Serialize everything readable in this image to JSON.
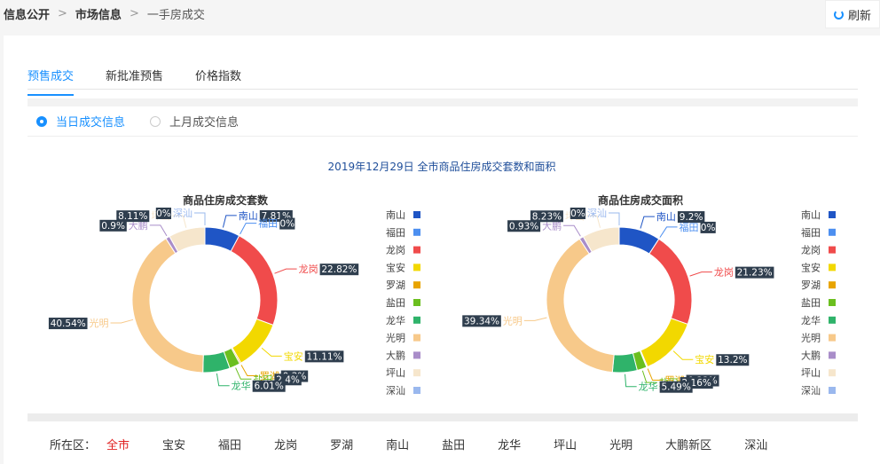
{
  "breadcrumb": [
    "信息公开",
    "市场信息",
    "一手房成交"
  ],
  "refresh_label": "刷新",
  "tabs": [
    "预售成交",
    "新批准预售",
    "价格指数"
  ],
  "radios": [
    "当日成交信息",
    "上月成交信息"
  ],
  "main_title": "2019年12月29日 全市商品住房成交套数和面积",
  "district_label": "所在区：",
  "districts": [
    "全市",
    "宝安",
    "福田",
    "龙岗",
    "罗湖",
    "南山",
    "盐田",
    "龙华",
    "坪山",
    "光明",
    "大鹏新区",
    "深汕"
  ],
  "colors": {
    "南山": "#1f55c5",
    "福田": "#4c8ff0",
    "龙岗": "#f04b4b",
    "宝安": "#f2d800",
    "罗湖": "#e8a400",
    "盐田": "#6bbf1f",
    "龙华": "#2fb36a",
    "光明": "#f7c98a",
    "大鹏": "#a98dc9",
    "坪山": "#f6e6cc",
    "深汕": "#9ab8ee"
  },
  "chart_data": [
    {
      "type": "pie",
      "title": "商品住房成交套数",
      "series": [
        {
          "values": [
            {
              "label": "南山",
              "pct": 7.81
            },
            {
              "label": "福田",
              "pct": 0
            },
            {
              "label": "龙岗",
              "pct": 22.82
            },
            {
              "label": "宝安",
              "pct": 11.11
            },
            {
              "label": "罗湖",
              "pct": 0.3
            },
            {
              "label": "盐田",
              "pct": 2.4
            },
            {
              "label": "龙华",
              "pct": 6.01
            },
            {
              "label": "光明",
              "pct": 40.54
            },
            {
              "label": "大鹏",
              "pct": 0.9
            },
            {
              "label": "坪山",
              "pct": 8.11
            },
            {
              "label": "深汕",
              "pct": 0
            }
          ]
        }
      ],
      "value_texts": [
        "7.81%",
        "0%",
        "22.82%",
        "11.11%",
        "0.3%",
        "2.4%",
        "6.01%",
        "40.54%",
        "0.9%",
        "8.11%",
        "0%"
      ],
      "legend": [
        "南山",
        "福田",
        "龙岗",
        "宝安",
        "罗湖",
        "盐田",
        "龙华",
        "光明",
        "大鹏",
        "坪山",
        "深汕"
      ],
      "legend_position": "right"
    },
    {
      "type": "pie",
      "title": "商品住房成交面积",
      "series": [
        {
          "values": [
            {
              "label": "南山",
              "pct": 9.2
            },
            {
              "label": "福田",
              "pct": 0
            },
            {
              "label": "龙岗",
              "pct": 21.23
            },
            {
              "label": "宝安",
              "pct": 13.2
            },
            {
              "label": "罗湖",
              "pct": 0.22
            },
            {
              "label": "盐田",
              "pct": 2.16
            },
            {
              "label": "龙华",
              "pct": 5.49
            },
            {
              "label": "光明",
              "pct": 39.34
            },
            {
              "label": "大鹏",
              "pct": 0.93
            },
            {
              "label": "坪山",
              "pct": 8.23
            },
            {
              "label": "深汕",
              "pct": 0
            }
          ]
        }
      ],
      "value_texts": [
        "9.2%",
        "0%",
        "21.23%",
        "13.2%",
        "0.22%",
        "2.16%",
        "5.49%",
        "39.34%",
        "0.93%",
        "8.23%",
        "0%"
      ],
      "legend": [
        "南山",
        "福田",
        "龙岗",
        "宝安",
        "罗湖",
        "盐田",
        "龙华",
        "光明",
        "大鹏",
        "坪山",
        "深汕"
      ],
      "legend_position": "right"
    }
  ]
}
